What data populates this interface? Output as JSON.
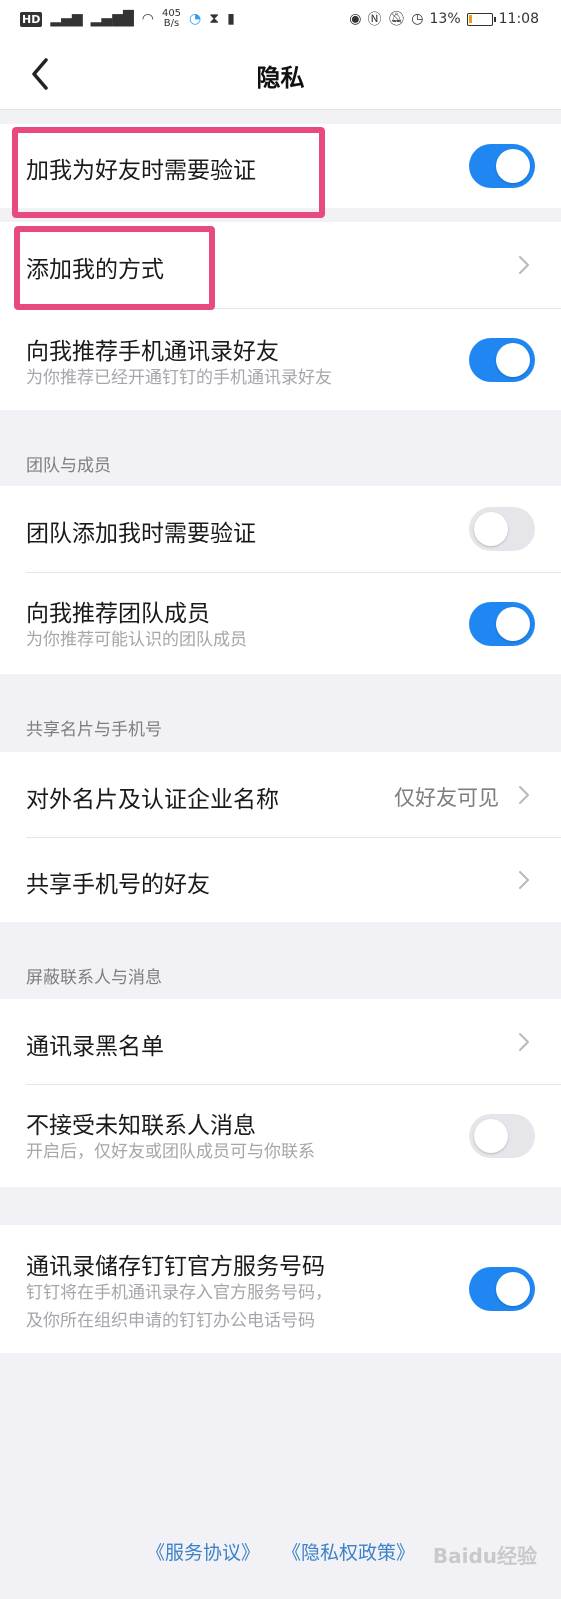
{
  "status_bar": {
    "network_speed_value": "405",
    "network_speed_unit": "B/s",
    "battery": "13%",
    "battery_level": 0.13,
    "time": "11:08"
  },
  "header": {
    "title": "隐私"
  },
  "rows": {
    "verify_friend": {
      "label": "加我为好友时需要验证",
      "on": true
    },
    "add_me_method": {
      "label": "添加我的方式"
    },
    "recommend_contacts": {
      "label": "向我推荐手机通讯录好友",
      "sub": "为你推荐已经开通钉钉的手机通讯录好友",
      "on": true
    },
    "team_verify": {
      "label": "团队添加我时需要验证",
      "on": false
    },
    "recommend_team": {
      "label": "向我推荐团队成员",
      "sub": "为你推荐可能认识的团队成员",
      "on": true
    },
    "card_company": {
      "label": "对外名片及认证企业名称",
      "value": "仅好友可见"
    },
    "share_phone": {
      "label": "共享手机号的好友"
    },
    "blacklist": {
      "label": "通讯录黑名单"
    },
    "reject_unknown": {
      "label": "不接受未知联系人消息",
      "sub": "开启后，仅好友或团队成员可与你联系",
      "on": false
    },
    "official_numbers": {
      "label": "通讯录储存钉钉官方服务号码",
      "sub1": "钉钉将在手机通讯录存入官方服务号码，",
      "sub2": "及你所在组织申请的钉钉办公电话号码",
      "on": true
    }
  },
  "sections": {
    "team": "团队与成员",
    "card_phone": "共享名片与手机号",
    "block": "屏蔽联系人与消息"
  },
  "footer": {
    "service": "《服务协议》",
    "privacy": "《隐私权政策》"
  },
  "watermark": "Baidu经验",
  "colors": {
    "accent": "#1f86f2",
    "highlight": "#e8497f",
    "link": "#3b82c9"
  }
}
